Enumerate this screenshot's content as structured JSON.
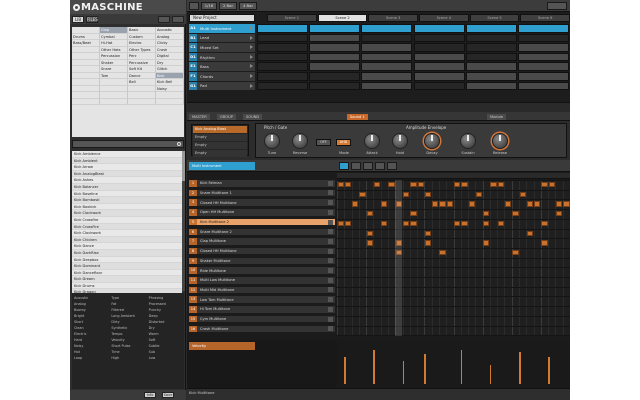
{
  "app": {
    "logo": "MASCHINE"
  },
  "browser": {
    "tabs": [
      "LIB",
      "FILES"
    ],
    "tag_columns": [
      [
        "",
        "Drums",
        "Bass/Beat",
        "",
        "",
        "",
        "",
        "",
        "",
        "",
        "",
        ""
      ],
      [
        "Clap",
        "Cymbal",
        "Hi-Hat",
        "Other Hats",
        "Percussion",
        "Shaker",
        "Snare",
        "Tom",
        "",
        "",
        "",
        ""
      ],
      [
        "Basic",
        "Custom",
        "Electro",
        "Other Types",
        "Perc",
        "Percussive",
        "Soft Kit",
        "Dance",
        "Bell",
        "",
        "",
        ""
      ],
      [
        "Acoustic",
        "Analog",
        "Clicky",
        "Crash",
        "Digital",
        "Dry",
        "Glitch",
        "Kick",
        "Kick Bell",
        "Noisy",
        "",
        ""
      ]
    ],
    "results": [
      "Kick Ambience",
      "Kick Ambient",
      "Kick Arrow",
      "Kick AnalogBlast",
      "Kick Ashes",
      "Kick Balancer",
      "Kick Baseline",
      "Kick Bombasti",
      "Kick Boxkick",
      "Kick Clockwork",
      "Kick Crossfire",
      "Kick CrossFire",
      "Kick Clockwork",
      "Kick Chicken",
      "Kick Dance",
      "Kick DarkRise",
      "Kick Deepbox",
      "Kick Dominant",
      "Kick Dancefloor",
      "Kick Dream",
      "Kick Drums",
      "Kick Dragon",
      "Kick Downtake",
      "Kick Decay"
    ],
    "attributes": [
      "Acoustic",
      "Type",
      "Phrasing",
      "Analog",
      "Fat",
      "Processed",
      "Boomy",
      "Filtered",
      "Punchy",
      "Bright",
      "Long Ambient",
      "Deep",
      "Short",
      "Dirty",
      "Distorted",
      "Clean",
      "Synthetic",
      "Dry",
      "Electric",
      "Tempo",
      "Warm",
      "Hard",
      "Velocity",
      "Soft",
      "Noisy",
      "Short Pulse",
      "Subtle",
      "Hot",
      "Time",
      "Sub",
      "Loop",
      "High",
      "Low"
    ],
    "footer_buttons": [
      "Info",
      "Save"
    ]
  },
  "arranger": {
    "project": "New Project",
    "scenes": [
      "Scene 1",
      "Scene 2",
      "Scene 3",
      "Scene 4",
      "Scene 5",
      "Scene 6"
    ],
    "active_scene": 1,
    "groups": [
      {
        "letter": "A1",
        "name": "Multi Instrument",
        "selected": true
      },
      {
        "letter": "B1",
        "name": "Lead",
        "selected": false
      },
      {
        "letter": "C1",
        "name": "Mixed Set",
        "selected": false
      },
      {
        "letter": "D1",
        "name": "Rhythm",
        "selected": false
      },
      {
        "letter": "E1",
        "name": "Bass",
        "selected": false
      },
      {
        "letter": "F1",
        "name": "Chords",
        "selected": false
      },
      {
        "letter": "G1",
        "name": "Pad",
        "selected": false
      }
    ],
    "clip_color": "#2f9fd0",
    "top_buttons": [
      "1/16",
      "2 Bar",
      "4 Bar"
    ]
  },
  "control": {
    "tabs": [
      "MASTER",
      "GROUP",
      "SOUND",
      "Sound 1",
      "Module"
    ],
    "slots": [
      "Kick Analog Blast",
      "Empty",
      "Empty",
      "Empty"
    ],
    "sections": [
      "Pitch / Gate",
      "Amplitude Envelope"
    ],
    "knobs": [
      "Tune",
      "Reverse",
      "Mode",
      "Attack",
      "Hold",
      "Decay",
      "Sustain",
      "Release"
    ],
    "buttons": [
      "OFF",
      "AHD"
    ]
  },
  "pattern": {
    "header": "Multi Instrument",
    "sounds": [
      "Kick Fatman",
      "Snare Multitone 1",
      "Closed HH Multitone",
      "Open HH Multitone",
      "Kick Multitone 2",
      "Snare Multitone 2",
      "Clap Multitone",
      "Closed HH Multitone",
      "Shaker Multitone",
      "Ride Multitone",
      "Multi Low Multitone",
      "Multi Mid Multitone",
      "Low Tom Multitone",
      "Hi Tom Multitone",
      "Cym Multitone",
      "Crash Multitone"
    ],
    "selected_sound": 4,
    "vel_label": "Velocity",
    "footer": "Kick Multitone",
    "note_color": "#c9722e",
    "notes": [
      {
        "row": 0,
        "steps": [
          0,
          1,
          5,
          7,
          10,
          11,
          16,
          17,
          21,
          22,
          28,
          29
        ]
      },
      {
        "row": 1,
        "steps": [
          3,
          9,
          12,
          19,
          25
        ]
      },
      {
        "row": 2,
        "steps": [
          2,
          6,
          8,
          13,
          14,
          15,
          18,
          23,
          26,
          27,
          30,
          31
        ]
      },
      {
        "row": 3,
        "steps": [
          4,
          10,
          20,
          24,
          30
        ]
      },
      {
        "row": 4,
        "steps": [
          0,
          1,
          6,
          9,
          10,
          16,
          17,
          20,
          22,
          28
        ]
      },
      {
        "row": 5,
        "steps": [
          4,
          12,
          26
        ]
      },
      {
        "row": 6,
        "steps": [
          4,
          8,
          12,
          20,
          28
        ]
      },
      {
        "row": 7,
        "steps": [
          8,
          14,
          24
        ]
      }
    ],
    "velocities": [
      {
        "step": 1,
        "value": 0.7
      },
      {
        "step": 5,
        "value": 0.9
      },
      {
        "step": 9,
        "value": 0.6
      },
      {
        "step": 12,
        "value": 0.8
      },
      {
        "step": 17,
        "value": 0.9
      },
      {
        "step": 21,
        "value": 0.5
      },
      {
        "step": 25,
        "value": 0.85
      },
      {
        "step": 29,
        "value": 0.7
      }
    ]
  }
}
